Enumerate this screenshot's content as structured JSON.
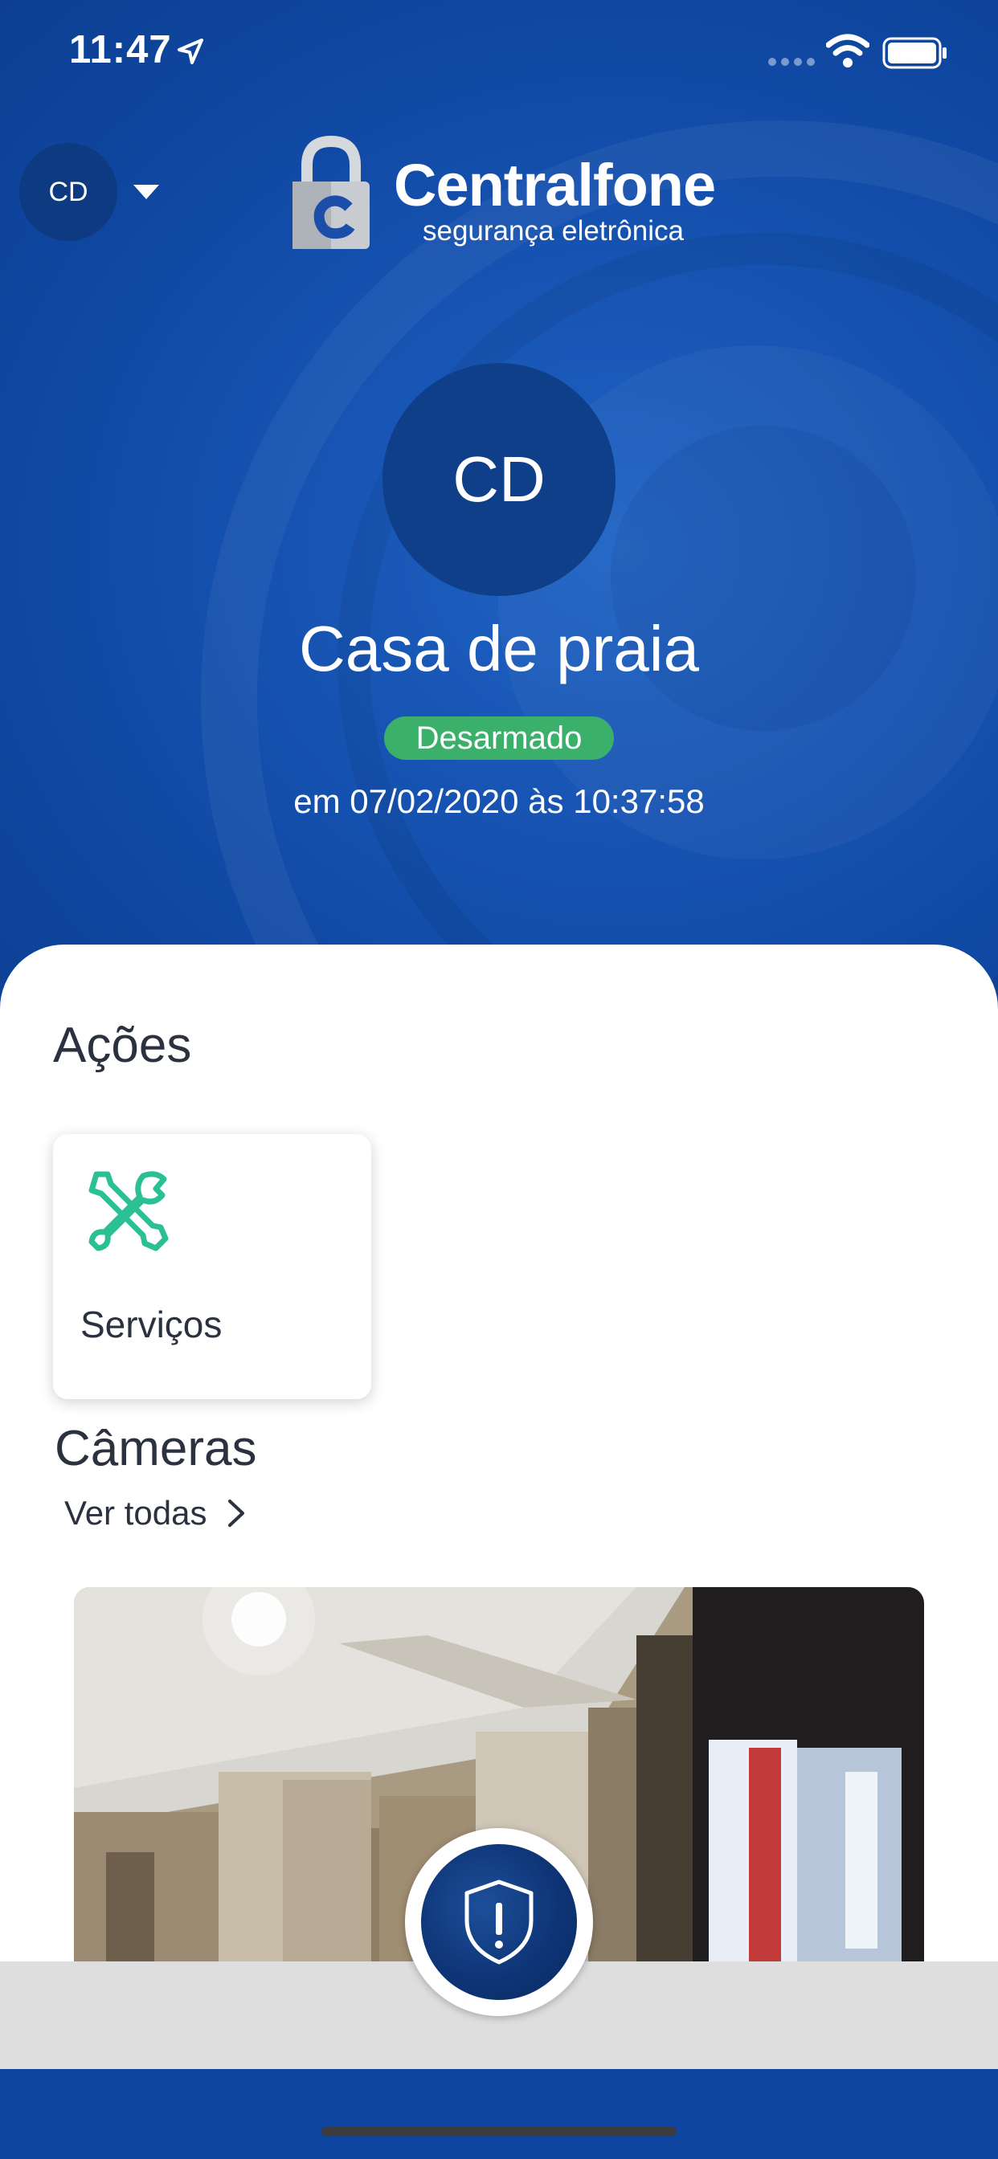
{
  "status_bar": {
    "time": "11:47"
  },
  "header": {
    "account_initials": "CD",
    "logo": {
      "name": "Centralfone",
      "tagline": "segurança eletrônica"
    }
  },
  "site": {
    "initials": "CD",
    "name": "Casa de praia",
    "status": "Desarmado",
    "status_time": "em 07/02/2020 às 10:37:58"
  },
  "actions": {
    "title": "Ações",
    "items": [
      {
        "label": "Serviços",
        "icon": "tools-icon"
      }
    ]
  },
  "cameras": {
    "title": "Câmeras",
    "see_all": "Ver todas"
  },
  "colors": {
    "brand_blue": "#0d45a0",
    "status_green": "#3ab06a",
    "accent_teal": "#2bbf94"
  }
}
